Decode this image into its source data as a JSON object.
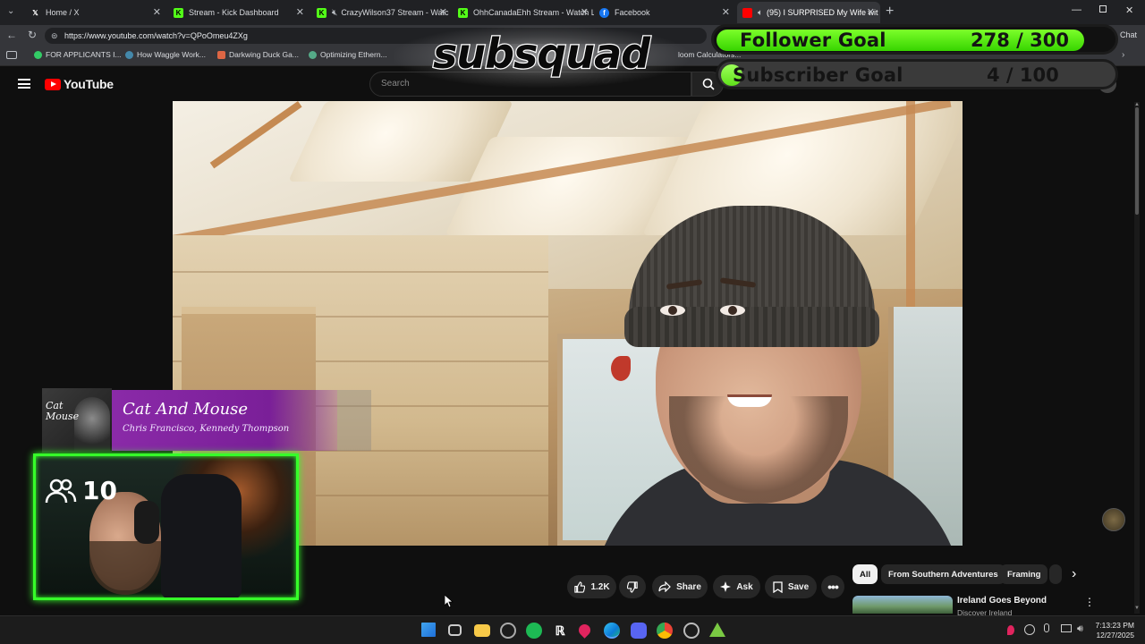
{
  "browser": {
    "tabs": [
      {
        "title": "Home / X",
        "icon": "x-logo-icon",
        "color": "#ffffff"
      },
      {
        "title": "Stream - Kick Dashboard",
        "icon": "kick-icon",
        "color": "#53fc18"
      },
      {
        "title": "CrazyWilson37 Stream - Watc",
        "icon": "kick-icon",
        "color": "#53fc18"
      },
      {
        "title": "OhhCanadaEhh Stream - Watch Li",
        "icon": "kick-icon",
        "color": "#53fc18"
      },
      {
        "title": "Facebook",
        "icon": "facebook-icon",
        "color": "#1877f2"
      },
      {
        "title": "(95) I SURPRISED My Wife wit",
        "icon": "youtube-icon",
        "color": "#ff0000"
      }
    ],
    "url": "https://www.youtube.com/watch?v=QPoOmeu4ZXg",
    "bookmarks": [
      "FOR APPLICANTS I...",
      "How Waggle Work...",
      "Darkwing Duck Ga...",
      "Optimizing Ethern...",
      "loom Calculators..."
    ],
    "chat_label": "Chat"
  },
  "youtube": {
    "logo_text": "YouTube",
    "search_placeholder": "Search",
    "actions": {
      "likes": "1.2K",
      "share": "Share",
      "ask": "Ask",
      "save": "Save"
    },
    "chips": [
      "All",
      "From Southern Adventures",
      "Framing"
    ],
    "related": {
      "title": "Ireland Goes Beyond",
      "channel": "Discover Ireland"
    }
  },
  "overlay": {
    "logo_text": "subsquad",
    "follower_goal": {
      "label": "Follower Goal",
      "value": "278 / 300",
      "progress": 0.927
    },
    "subscriber_goal": {
      "label": "Subscriber Goal",
      "value": "4 / 100",
      "progress": 0.04
    },
    "now_playing": {
      "title": "Cat And Mouse",
      "artist": "Chris Francisco, Kennedy Thompson",
      "art_text": "Cat Mouse"
    },
    "viewer_count": "10"
  },
  "taskbar": {
    "time": "7:13:23 PM",
    "date": "12/27/2025"
  },
  "colors": {
    "goal_green": "#37d400",
    "webcam_border": "#36ff29",
    "music_purple": "#8a2aa8",
    "youtube_red": "#ff0000"
  }
}
